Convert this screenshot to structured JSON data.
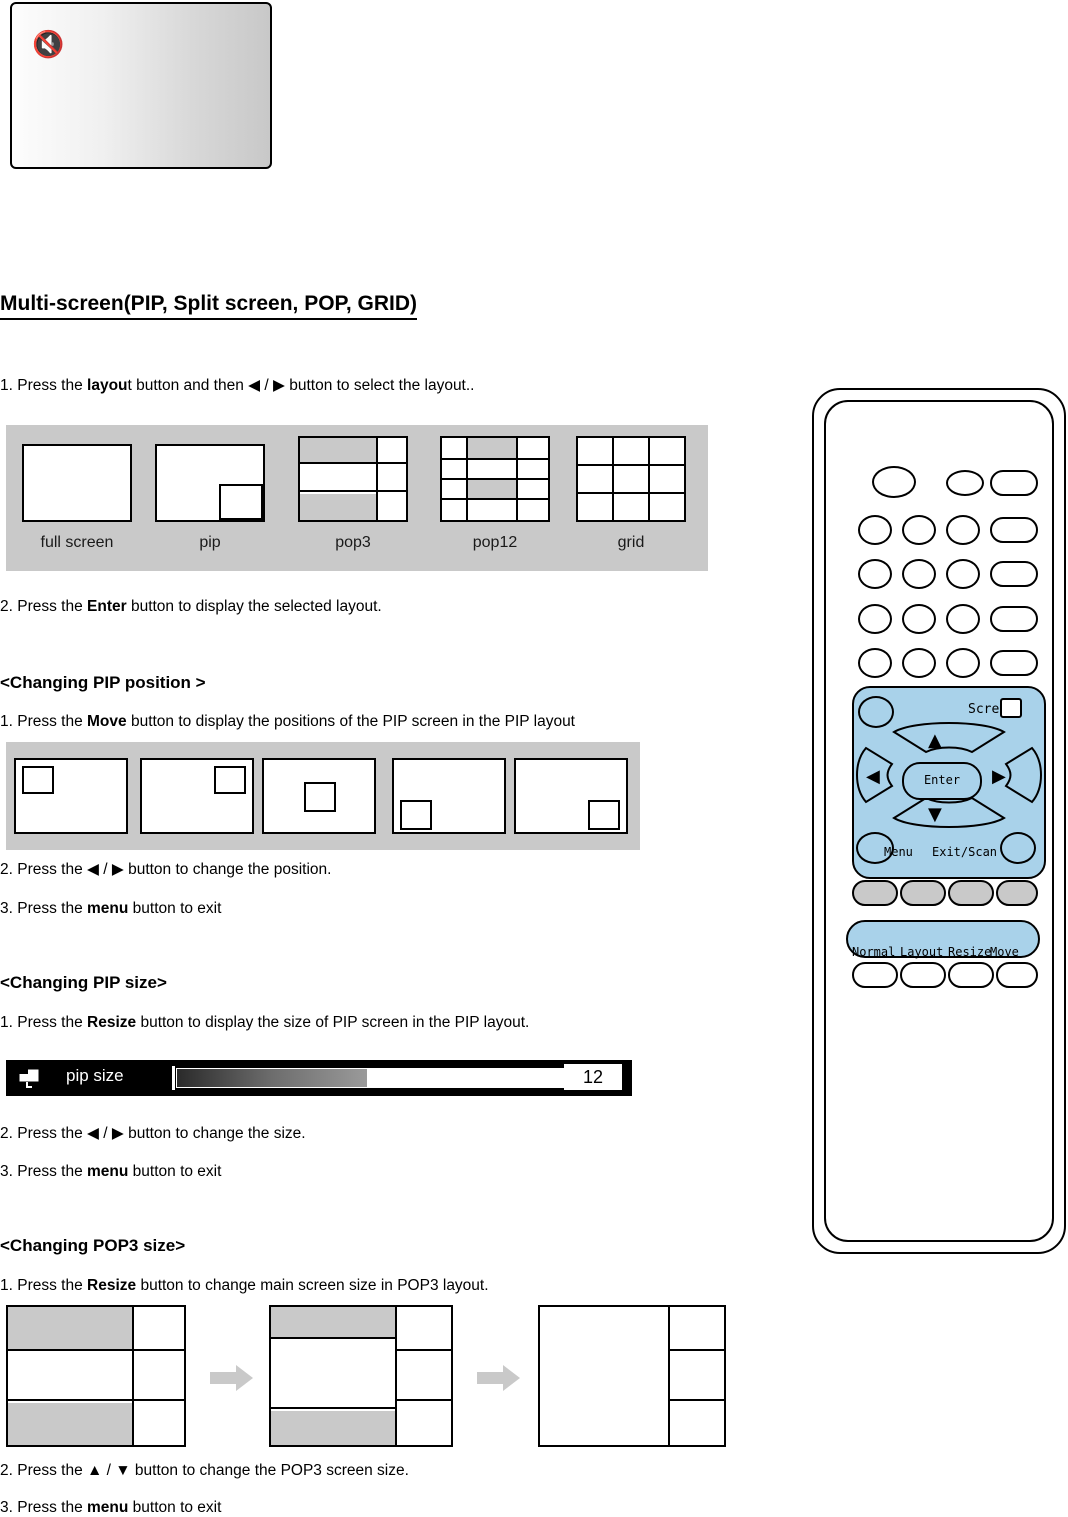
{
  "document": {
    "title": "Multi-screen(PIP, Split screen, POP, GRID)",
    "mute_icon": "mute-icon"
  },
  "steps_main": [
    {
      "id": "s1",
      "text_before": "1. Press the ",
      "bold": "layou",
      "text_after": "t button and then ◀ / ▶ button to select the layout.."
    },
    {
      "id": "s2",
      "text_before": "2. Press the ",
      "bold": "Enter",
      "text_after": " button to display the selected layout."
    }
  ],
  "layout_strip": {
    "captions": [
      "full screen",
      "pip",
      "pop3",
      "pop12",
      "grid"
    ]
  },
  "sections": [
    {
      "heading": "<Changing PIP position >",
      "lines": [
        {
          "pre": "1. Press the ",
          "bold": "Move",
          "post": " button to display the positions of the PIP screen in the PIP layout"
        },
        {
          "pre": "2. Press the ◀ / ▶ button to change the position.",
          "bold": "",
          "post": ""
        },
        {
          "pre": "3. Press the ",
          "bold": "menu",
          "post": " button to exit"
        }
      ]
    },
    {
      "heading": "<Changing PIP size>",
      "lines": [
        {
          "pre": "1. Press the ",
          "bold": "Resize",
          "post": " button to display the size of PIP screen in the PIP layout."
        },
        {
          "pre": "2. Press the ◀ / ▶ button to change the size.",
          "bold": "",
          "post": ""
        },
        {
          "pre": "3. Press the ",
          "bold": "menu",
          "post": " button to exit"
        }
      ]
    },
    {
      "heading": "<Changing POP3 size>",
      "lines": [
        {
          "pre": "1. Press the ",
          "bold": "Resize",
          "post": " button to change main screen size in POP3 layout."
        },
        {
          "pre": "2. Press the ▲ / ▼ button to change the POP3 screen size.",
          "bold": "",
          "post": ""
        },
        {
          "pre": "3. Press the ",
          "bold": "menu",
          "post": " button to exit"
        }
      ]
    }
  ],
  "pip_size_osd": {
    "label": "pip size",
    "value": "12",
    "icon": "pip-size-icon"
  },
  "remote": {
    "screen_label": "Screen",
    "enter_label": "Enter",
    "menu_label": "Menu",
    "exit_scan_label": "Exit/Scan",
    "bottom_labels": [
      "Normal",
      "Layout",
      "Resize",
      "Move"
    ],
    "up_icon": "▲",
    "down_icon": "▼",
    "left_icon": "◀",
    "right_icon": "▶"
  },
  "colors": {
    "band_gray": "#c9c9c9",
    "cell_gray": "#c9c9c9",
    "remote_blue": "#a9d2ea",
    "osd_black": "#000000"
  }
}
